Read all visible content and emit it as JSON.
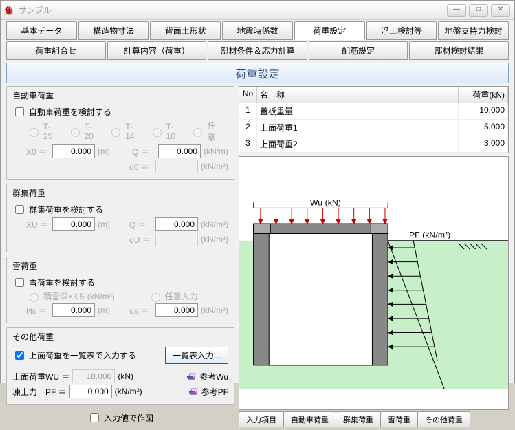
{
  "title": "サンプル",
  "tabs1": [
    "基本データ",
    "構造物寸法",
    "背面土形状",
    "地震時係数",
    "荷重設定",
    "浮上検討等",
    "地盤支持力検討"
  ],
  "tabs1_active": 4,
  "tabs2": [
    "荷重組合せ",
    "計算内容（荷重）",
    "部材条件＆応力計算",
    "配筋設定",
    "部材検討結果"
  ],
  "banner": "荷重設定",
  "auto": {
    "title": "自動車荷重",
    "chk": "自動車荷重を検討する",
    "opts": [
      "T-25",
      "T-20",
      "T-14",
      "T-10",
      "任意"
    ],
    "x": "X0 ＝",
    "xu": "(m)",
    "q": "Q  ＝",
    "qu": "(kN/m)",
    "q0": "q0 ＝",
    "q0u": "(kN/m²)",
    "xv": "0.000",
    "qv": "0.000"
  },
  "grp": {
    "title": "群集荷重",
    "chk": "群集荷重を検討する",
    "x": "XU ＝",
    "xu": "(m)",
    "q": "Q  ＝",
    "qu": "(kN/m²)",
    "qU": "qU ＝",
    "qUu": "(kN/m²)",
    "xv": "0.000",
    "qv": "0.000"
  },
  "snow": {
    "title": "雪荷重",
    "chk": "雪荷重を検討する",
    "opt1": "積雪深×3.5",
    "u1": "(kN/m³)",
    "opt2": "任意入力",
    "h": "Hs ＝",
    "hu": "(m)",
    "q": "qs ＝",
    "qu": "(kN/m²)",
    "hv": "0.000",
    "qv": "0.000"
  },
  "other": {
    "title": "その他荷重",
    "chk": "上面荷重を一覧表で入力する",
    "btn": "一覧表入力...",
    "wu": "上面荷重WU ＝",
    "wuu": "(kN)",
    "wuv": "18.000",
    "pf": "凍上力　PF ＝",
    "pfu": "(kN/m²)",
    "pfv": "0.000",
    "ref1": "参考Wu",
    "ref2": "参考PF"
  },
  "footer": "入力値で作図",
  "table": {
    "h_no": "No",
    "h_nm": "名　称",
    "h_ld": "荷重(kN)",
    "rows": [
      {
        "no": "1",
        "nm": "蓋板重量",
        "ld": "10.000"
      },
      {
        "no": "2",
        "nm": "上面荷重1",
        "ld": "5.000"
      },
      {
        "no": "3",
        "nm": "上面荷重2",
        "ld": "3.000"
      }
    ]
  },
  "btabs": [
    "入力項目",
    "自動車荷重",
    "群集荷重",
    "雪荷重",
    "その他荷重"
  ],
  "diag": {
    "wu": "Wu (kN)",
    "pf": "PF (kN/m²)"
  }
}
